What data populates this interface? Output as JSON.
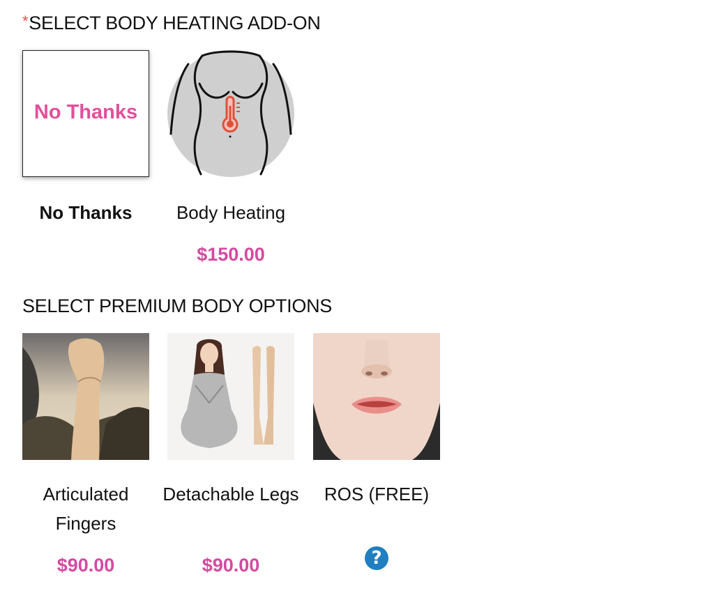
{
  "heating": {
    "required_mark": "*",
    "title": "SELECT BODY HEATING ADD-ON",
    "options": [
      {
        "thumb_text": "No Thanks",
        "label": "No Thanks",
        "price": ""
      },
      {
        "label": "Body Heating",
        "price": "$150.00"
      }
    ]
  },
  "premium": {
    "title": "SELECT PREMIUM BODY OPTIONS",
    "options": [
      {
        "label": "Articulated Fingers",
        "price": "$90.00"
      },
      {
        "label": "Detachable Legs",
        "price": "$90.00"
      },
      {
        "label": "ROS (FREE)",
        "help_icon": "?"
      }
    ]
  },
  "colors": {
    "price": "#d34aa0",
    "no_thanks_text": "#e0509a",
    "help_icon": "#1f7fc1",
    "required": "#d9534f"
  }
}
